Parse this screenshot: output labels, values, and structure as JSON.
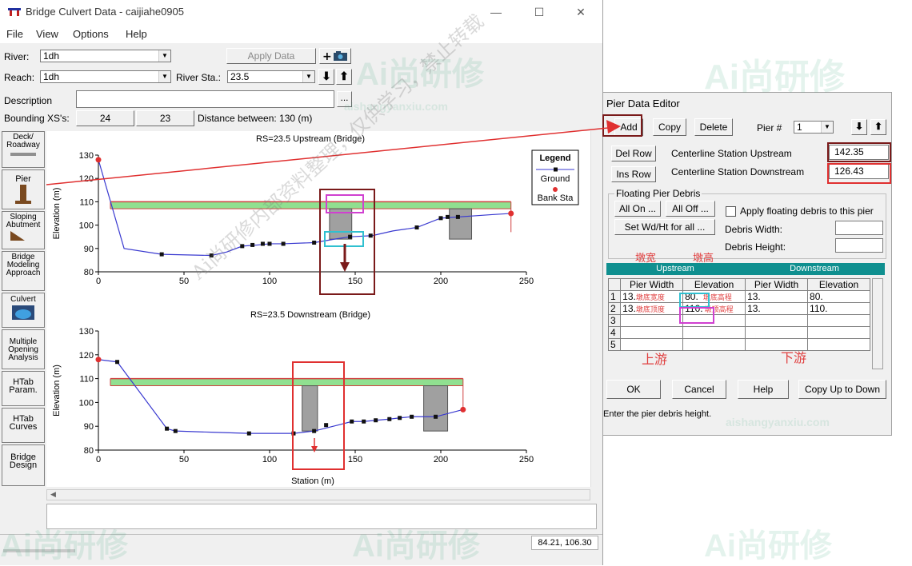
{
  "window": {
    "title": "Bridge Culvert Data - caijiahe0905",
    "minimize": "—",
    "maximize": "☐",
    "close": "✕"
  },
  "menu": [
    "File",
    "View",
    "Options",
    "Help"
  ],
  "form": {
    "river_label": "River:",
    "river_value": "1dh",
    "apply_label": "Apply Data",
    "reach_label": "Reach:",
    "reach_value": "1dh",
    "river_sta_label": "River Sta.:",
    "river_sta_value": "23.5",
    "description_label": "Description",
    "bounding_label": "Bounding XS's:",
    "bounding_up": "24",
    "bounding_down": "23",
    "distance_text": "Distance between: 130 (m)",
    "ellipsis": "..."
  },
  "tools": [
    {
      "label": "Deck/ Roadway"
    },
    {
      "label": "Pier"
    },
    {
      "label": "Sloping Abutment"
    },
    {
      "label": "Bridge Modeling Approach"
    },
    {
      "label": "Culvert"
    },
    {
      "label": "Multiple Opening Analysis"
    },
    {
      "label": "HTab Param."
    },
    {
      "label": "HTab Curves"
    },
    {
      "label": "Bridge Design"
    }
  ],
  "plots": {
    "upstream_title": "RS=23.5    Upstream  (Bridge)",
    "downstream_title": "RS=23.5    Downstream  (Bridge)",
    "ylabel": "Elevation (m)",
    "xlabel": "Station (m)",
    "yticks": [
      "130",
      "120",
      "110",
      "100",
      "90",
      "80"
    ],
    "xticks": [
      "0",
      "50",
      "100",
      "150",
      "200",
      "250"
    ],
    "legend_title": "Legend",
    "legend_ground": "Ground",
    "legend_bank": "Bank Sta",
    "colors": {
      "ground": "#3a3ad0",
      "deck": "#d04040",
      "deck_fill": "#90e090",
      "pier": "#a0a0a0",
      "bank": "#e03030"
    }
  },
  "status": {
    "coords": "84.21, 106.30"
  },
  "pier_editor": {
    "title": "Pier Data Editor",
    "add": "Add",
    "copy": "Copy",
    "delete": "Delete",
    "pier_no_label": "Pier #",
    "pier_no_value": "1",
    "del_row": "Del Row",
    "ins_row": "Ins Row",
    "cl_up_label": "Centerline Station Upstream",
    "cl_up_value": "142.35",
    "cl_down_label": "Centerline Station Downstream",
    "cl_down_value": "126.43",
    "debris_group": "Floating Pier Debris",
    "all_on": "All On ...",
    "all_off": "All Off ...",
    "apply_debris": "Apply floating debris to this pier",
    "set_wd": "Set Wd/Ht for all ...",
    "debris_width": "Debris Width:",
    "debris_height": "Debris Height:",
    "annot_width": "墩宽",
    "annot_height": "墩高",
    "upstream": "Upstream",
    "downstream": "Downstream",
    "col_headers": [
      "Pier Width",
      "Elevation",
      "Pier Width",
      "Elevation"
    ],
    "rows": [
      {
        "n": "1",
        "w1": "13.",
        "w1_note": "墩底宽度",
        "e1": "80.",
        "e1_note": "墩底高程",
        "w2": "13.",
        "e2": "80."
      },
      {
        "n": "2",
        "w1": "13.",
        "w1_note": "墩底顶度",
        "e1": "110.",
        "e1_note": "墩顶高程",
        "w2": "13.",
        "e2": "110."
      },
      {
        "n": "3"
      },
      {
        "n": "4"
      },
      {
        "n": "5"
      }
    ],
    "annot_up": "上游",
    "annot_down": "下游",
    "ok": "OK",
    "cancel": "Cancel",
    "help": "Help",
    "copy_up_down": "Copy Up to Down",
    "status": "Enter the pier debris height."
  },
  "watermarks": {
    "brand": "Ai尚研修",
    "site": "aishangyanxiu.com",
    "diag": "Ai尚研修内部资料整理，仅供学习，禁止转载"
  }
}
